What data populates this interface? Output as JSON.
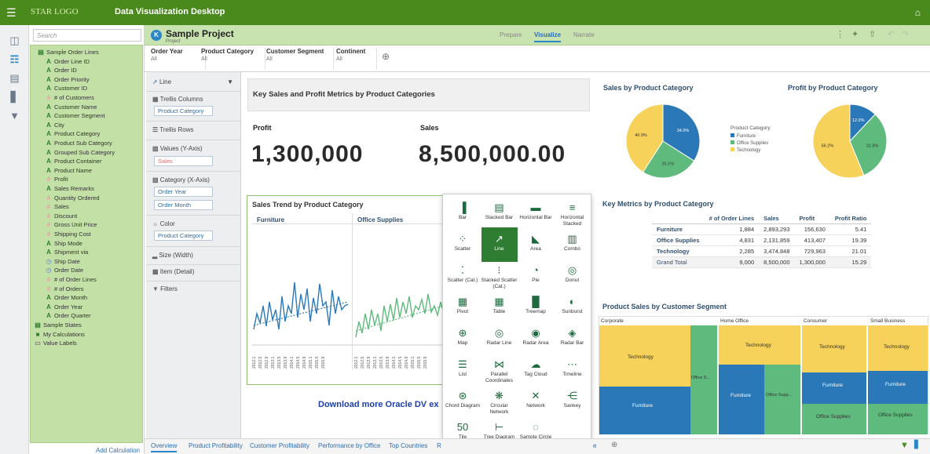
{
  "topbar": {
    "menu_icon": "☰",
    "brand": "STAR LOGO",
    "app_title": "Data Visualization Desktop",
    "home_icon": "⌂"
  },
  "search": {
    "placeholder": "Search"
  },
  "tree": {
    "items": [
      {
        "label": "Sample Order Lines",
        "type": "dataset"
      },
      {
        "label": "Order Line ID",
        "type": "A"
      },
      {
        "label": "Order ID",
        "type": "A"
      },
      {
        "label": "Order Priority",
        "type": "A"
      },
      {
        "label": "Customer ID",
        "type": "A"
      },
      {
        "label": "# of Customers",
        "type": "M"
      },
      {
        "label": "Customer Name",
        "type": "A"
      },
      {
        "label": "Customer Segment",
        "type": "A"
      },
      {
        "label": "City",
        "type": "A"
      },
      {
        "label": "Product Category",
        "type": "A"
      },
      {
        "label": "Product Sub Category",
        "type": "A"
      },
      {
        "label": "Grouped Sub Category",
        "type": "A"
      },
      {
        "label": "Product Container",
        "type": "A"
      },
      {
        "label": "Product Name",
        "type": "A"
      },
      {
        "label": "Profit",
        "type": "M"
      },
      {
        "label": "Sales Remarks",
        "type": "A"
      },
      {
        "label": "Quantity Ordered",
        "type": "M"
      },
      {
        "label": "Sales",
        "type": "M"
      },
      {
        "label": "Discount",
        "type": "M"
      },
      {
        "label": "Gross Unit Price",
        "type": "M"
      },
      {
        "label": "Shipping Cost",
        "type": "M"
      },
      {
        "label": "Ship Mode",
        "type": "A"
      },
      {
        "label": "Shipment via",
        "type": "A"
      },
      {
        "label": "Ship Date",
        "type": "T"
      },
      {
        "label": "Order Date",
        "type": "T"
      },
      {
        "label": "# of Order Lines",
        "type": "M"
      },
      {
        "label": "# of Orders",
        "type": "M"
      },
      {
        "label": "Order Month",
        "type": "A"
      },
      {
        "label": "Order Year",
        "type": "A"
      },
      {
        "label": "Order Quarter",
        "type": "A"
      },
      {
        "label": "Sample States",
        "type": "dataset"
      },
      {
        "label": "My Calculations",
        "type": "folder"
      },
      {
        "label": "Value Labels",
        "type": "vl"
      }
    ],
    "add_calc": "Add Calculation"
  },
  "project": {
    "title": "Sample Project",
    "subtitle": "Project",
    "tabs": [
      "Prepare",
      "Visualize",
      "Narrate"
    ]
  },
  "filters": [
    {
      "name": "Order Year",
      "value": "All"
    },
    {
      "name": "Product Category",
      "value": "All"
    },
    {
      "name": "Customer Segment",
      "value": "All"
    },
    {
      "name": "Continent",
      "value": "All"
    }
  ],
  "grammar": {
    "viz_type": "Line",
    "trellis_columns": "Trellis Columns",
    "trellis_columns_pill": "Product Category",
    "trellis_rows": "Trellis Rows",
    "values": "Values (Y-Axis)",
    "values_pill": "Sales",
    "category": "Category (X-Axis)",
    "category_pills": [
      "Order Year",
      "Order Month"
    ],
    "color": "Color",
    "color_pill": "Product Category",
    "size": "Size (Width)",
    "item": "Item (Detail)",
    "filters": "Filters"
  },
  "kpi": {
    "title": "Key Sales and Profit Metrics by Product Categories",
    "profit_label": "Profit",
    "profit_value": "1,300,000",
    "sales_label": "Sales",
    "sales_value": "8,500,000.00"
  },
  "trend": {
    "title": "Sales Trend by Product Category",
    "columns": [
      "Furniture",
      "Office Supplies"
    ]
  },
  "download_text": "Download more Oracle DV ex",
  "pies": {
    "sales_title": "Sales by Product Category",
    "profit_title": "Profit by Product Category",
    "legend_title": "Product Category",
    "legend": [
      {
        "name": "Furniture",
        "color": "#2a78b7"
      },
      {
        "name": "Office Supplies",
        "color": "#5fba7d"
      },
      {
        "name": "Technology",
        "color": "#f6d25a"
      }
    ],
    "sales_labels": [
      "34.0%",
      "25.1%",
      "40.9%"
    ],
    "profit_labels": [
      "12.0%",
      "31.8%",
      "56.2%"
    ]
  },
  "chart_data": [
    {
      "type": "pie",
      "title": "Sales by Product Category",
      "categories": [
        "Furniture",
        "Office Supplies",
        "Technology"
      ],
      "values": [
        34.0,
        25.1,
        40.9
      ]
    },
    {
      "type": "pie",
      "title": "Profit by Product Category",
      "categories": [
        "Furniture",
        "Office Supplies",
        "Technology"
      ],
      "values": [
        12.0,
        31.8,
        56.2
      ]
    },
    {
      "type": "table",
      "title": "Key Metrics by Product Category",
      "columns": [
        "# of Order Lines",
        "Sales",
        "Profit",
        "Profit Ratio"
      ],
      "rows": [
        [
          "Furniture",
          "1,884",
          "2,893,293",
          "156,630",
          "5.41"
        ],
        [
          "Office Supplies",
          "4,831",
          "2,131,859",
          "413,407",
          "19.39"
        ],
        [
          "Technology",
          "2,285",
          "3,474,848",
          "729,963",
          "21.01"
        ],
        [
          "Grand Total",
          "9,000",
          "8,500,000",
          "1,300,000",
          "15.29"
        ]
      ]
    }
  ],
  "metrics": {
    "title": "Key Metrics by Product Category",
    "header": [
      "",
      "# of Order Lines",
      "Sales",
      "Profit",
      "Profit Ratio"
    ],
    "rows": [
      [
        "Furniture",
        "1,884",
        "2,893,293",
        "156,630",
        "5.41"
      ],
      [
        "Office Supplies",
        "4,831",
        "2,131,859",
        "413,407",
        "19.39"
      ],
      [
        "Technology",
        "2,285",
        "3,474,848",
        "729,963",
        "21.01"
      ],
      [
        "Grand Total",
        "9,000",
        "8,500,000",
        "1,300,000",
        "15.29"
      ]
    ]
  },
  "treemap": {
    "title": "Product Sales by Customer Segment",
    "segments": [
      "Corporate",
      "Home Office",
      "Consumer",
      "Small Business"
    ],
    "labels": {
      "tech": "Technology",
      "furn": "Furniture",
      "office": "Office Supplies",
      "office_s": "Office S...",
      "office_supp": "Office Supp..."
    }
  },
  "picker": [
    [
      "Bar",
      "Stacked Bar",
      "Horizontal Bar",
      "Horizontal Stacked"
    ],
    [
      "Scatter",
      "Line",
      "Area",
      "Combo"
    ],
    [
      "Scatter (Cat.)",
      "Stacked Scatter (Cat.)",
      "Pie",
      "Donut"
    ],
    [
      "Pivot",
      "Table",
      "Treemap",
      "Sunburst"
    ],
    [
      "Map",
      "Radar Line",
      "Radar Area",
      "Radar Bar"
    ],
    [
      "List",
      "Parallel Coordinates",
      "Tag Cloud",
      "Timeline"
    ],
    [
      "Chord Diagram",
      "Circular Network",
      "Network",
      "Sankey"
    ],
    [
      "Tile",
      "Tree Diagram",
      "Sample Circle Pack",
      ""
    ]
  ],
  "bottom_tabs": [
    "Overview",
    "Product Profitability",
    "Customer Profitability",
    "Performance by Office",
    "Top Countries",
    "R"
  ],
  "bottom_extra": "e"
}
